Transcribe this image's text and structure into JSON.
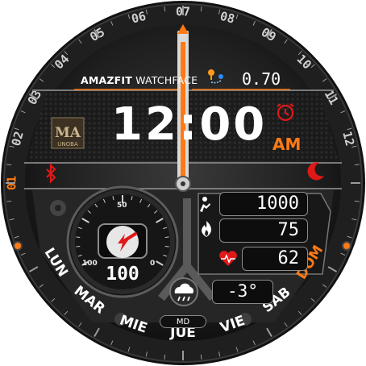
{
  "watch": {
    "brand_bold": "AMAZFIT",
    "brand_rest": " WATCHFACE",
    "time": "12:00",
    "ampm": "AM",
    "distance": "0.70",
    "steps": "1000",
    "calories": "75",
    "heart_rate": "62",
    "gauge_value": "100",
    "gauge_labels": {
      "top": "50",
      "left": "100",
      "right": "0"
    },
    "temperature": "-3°",
    "weather_label": "MD",
    "logo_text": "UNOBA"
  },
  "bezel": {
    "numbers": [
      "01",
      "02",
      "03",
      "04",
      "05",
      "06",
      "07",
      "08",
      "09",
      "10",
      "11",
      "12"
    ]
  },
  "weekdays": {
    "items": [
      "LUN",
      "MAR",
      "MIE",
      "JUE",
      "VIE",
      "SAB",
      "DOM"
    ],
    "active_index": 6
  },
  "icons": [
    "bluetooth-icon",
    "alarm-icon",
    "moon-icon",
    "distance-pin-icon",
    "steps-icon",
    "calories-icon",
    "heart-icon",
    "cloud-rain-icon",
    "lightning-icon"
  ],
  "colors": {
    "accent": "#ff7a14",
    "red": "#e01818",
    "bezel": "#1c1c1c",
    "text": "#ffffff"
  }
}
